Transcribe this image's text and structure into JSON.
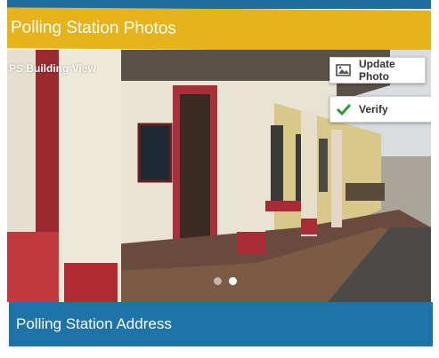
{
  "header": {
    "title": "Polling Station Photos"
  },
  "photo": {
    "label": "PS Building View",
    "slides_total": 2,
    "active_slide": 2
  },
  "actions": {
    "update_photo": "Update Photo",
    "verify": "Verify"
  },
  "address": {
    "title": "Polling Station Address"
  },
  "colors": {
    "header_bg": "#e7b31b",
    "section_bg": "#1e73a8",
    "verify_check": "#2e9b2e"
  },
  "icons": {
    "update": "image-upload-icon",
    "verify": "checkmark-icon"
  }
}
